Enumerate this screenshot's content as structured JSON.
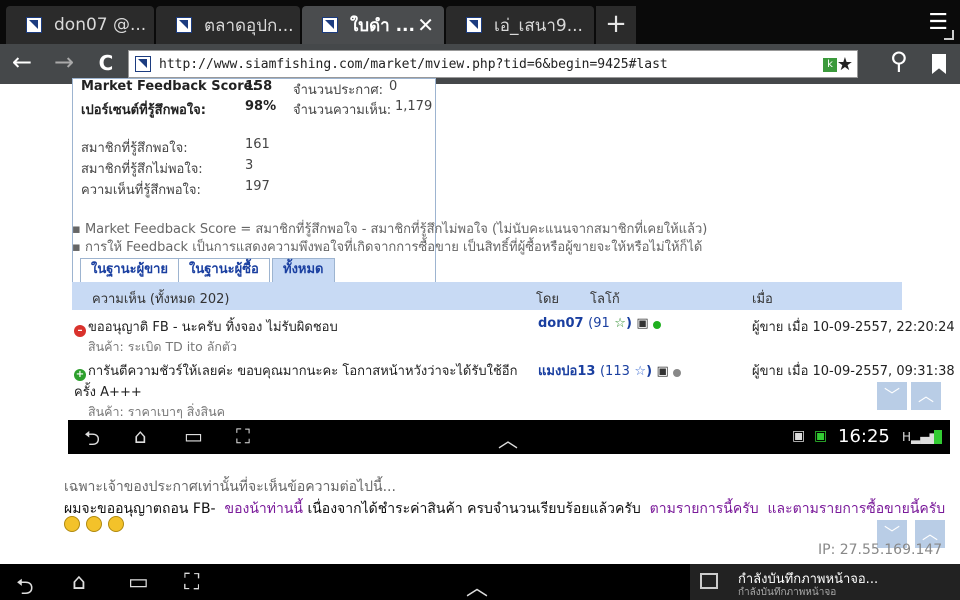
{
  "tabs": [
    {
      "label": "don07 @..."
    },
    {
      "label": "ตลาดอุปก..."
    },
    {
      "label": "ใบดำ ..."
    },
    {
      "label": "เอ่_เสนา9..."
    }
  ],
  "tabbar": {
    "new_tab": "+",
    "menu": "☰",
    "close": "✕"
  },
  "nav": {
    "back": "←",
    "forward": "→",
    "reload": "C",
    "url": "http://www.siamfishing.com/market/mview.php?tid=6&begin=9425#last",
    "search": "⚲",
    "bookmark": "★",
    "k_badge": "k"
  },
  "feedback": {
    "score_label": "Market Feedback Score:",
    "score_value": "158",
    "announce_label": "จำนวนประกาศ:",
    "announce_value": "0",
    "pct_label": "เปอร์เซนต์ที่รู้สึกพอใจ:",
    "pct_value": "98%",
    "comments_label": "จำนวนความเห็น:",
    "comments_value": "1,179",
    "pos_label": "สมาชิกที่รู้สึกพอใจ:",
    "pos_value": "161",
    "neg_label": "สมาชิกที่รู้สึกไม่พอใจ:",
    "neg_value": "3",
    "pos_comments_label": "ความเห็นที่รู้สึกพอใจ:",
    "pos_comments_value": "197"
  },
  "notes": [
    "Market Feedback Score = สมาชิกที่รู้สึกพอใจ - สมาชิกที่รู้สึกไม่พอใจ (ไม่นับคะแนนจากสมาชิกที่เคยให้แล้ว)",
    "การให้ Feedback เป็นการแสดงความพึงพอใจที่เกิดจากการซื้อขาย เป็นสิทธิ์ที่ผู้ซื้อหรือผู้ขายจะให้หรือไม่ให้ก็ได้"
  ],
  "page_tabs": [
    "ในฐานะผู้ขาย",
    "ในฐานะผู้ซื้อ",
    "ทั้งหมด"
  ],
  "table": {
    "col_comment": "ความเห็น (ทั้งหมด 202)",
    "col_by": "โดย",
    "col_logo": "โลโก้",
    "col_when": "เมื่อ",
    "rows": [
      {
        "comment": "ขออนุญาติ FB - นะครับ ทิ้งจอง ไม่รับผิดชอบ",
        "product": "สินค้า: ระเบิด TD ito ลักตัว",
        "user": "don07",
        "score": "(91",
        "when": "ผู้ขาย เมื่อ 10-09-2557, 22:20:24",
        "status": "negative"
      },
      {
        "comment": "การันตีความชัวร์ให้เลยค่ะ ขอบคุณมากนะคะ โอกาสหน้าหวังว่าจะได้รับใช้อีกครั้ง A+++",
        "product": "สินค้า: ราคาเบาๆ สิ่งสินค",
        "user": "แมงปอ13",
        "score": "(113",
        "when": "ผู้ขาย เมื่อ 10-09-2557, 09:31:38",
        "status": "positive"
      }
    ]
  },
  "inner_statusbar": {
    "time": "16:25"
  },
  "post": {
    "line1": "เฉพาะเจ้าของประกาศเท่านั้นที่จะเห็นข้อความต่อไปนี้...",
    "line2_prefix": "ผมจะขออนุญาตถอน FB-",
    "link1": "ของน้าท่านนี้",
    "line2_mid": "เนื่องจากได้ชำระค่าสินค้า ครบจำนวนเรียบร้อยแล้วครับ",
    "link2": "ตามรายการนี้ครับ",
    "link3": "และตามรายการซื้อขายนี้ครับ",
    "ip": "IP: 27.55.169.147"
  },
  "notification": {
    "title": "กำลังบันทึกภาพหน้าจอ...",
    "subtitle": "กำลังบันทึกภาพหน้าจอ"
  }
}
